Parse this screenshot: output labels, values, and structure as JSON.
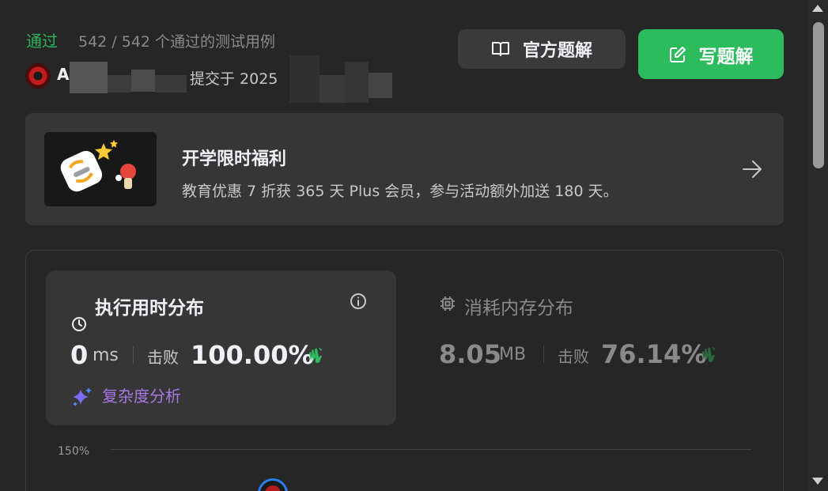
{
  "header": {
    "status": "通过",
    "testcases": "542 / 542 个通过的测试用例",
    "username": "A",
    "submitted": "提交于 2025",
    "official_solution": "官方题解",
    "write_solution": "写题解"
  },
  "promo": {
    "title": "开学限时福利",
    "description": "教育优惠 7 折获 365 天 Plus 会员，参与活动额外加送 180 天。"
  },
  "runtime": {
    "title": "执行用时分布",
    "value": "0",
    "unit": "ms",
    "beats_label": "击败",
    "beats": "100.00%",
    "complexity": "复杂度分析"
  },
  "memory": {
    "title": "消耗内存分布",
    "value": "8.05",
    "unit": "MB",
    "beats_label": "击败",
    "beats": "76.14%"
  },
  "chart": {
    "y_tick": "150%"
  },
  "colors": {
    "accept": "#2db55d",
    "primary_button": "#2cbb5d",
    "complexity": "#a678e6"
  }
}
